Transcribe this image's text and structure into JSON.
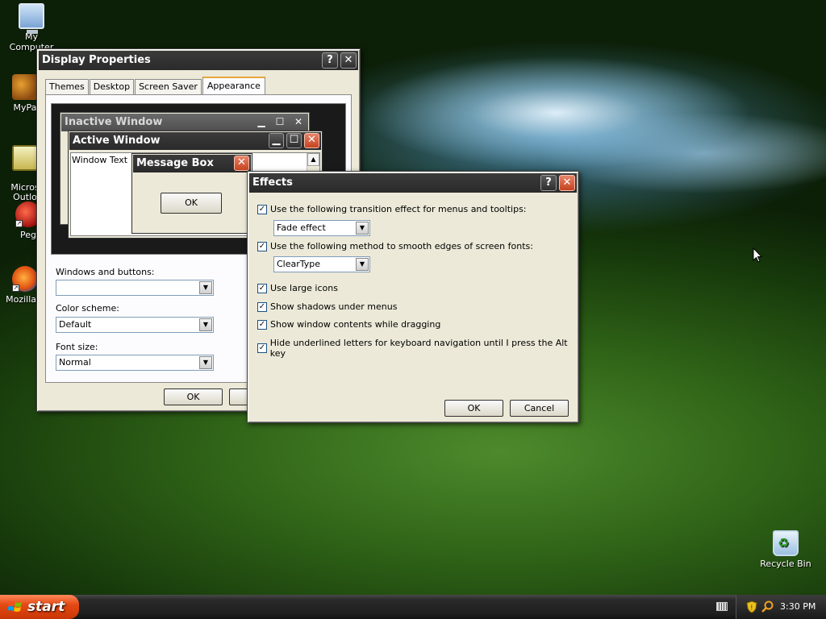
{
  "desktop": {
    "icons": [
      {
        "label": "My Computer"
      },
      {
        "label": "MyPa"
      },
      {
        "label": "Micros\nOutlo"
      },
      {
        "label": "Peg"
      },
      {
        "label": "Mozilla F"
      },
      {
        "label": "Recycle Bin"
      }
    ]
  },
  "display_properties": {
    "title": "Display Properties",
    "help": "?",
    "close": "✕",
    "tabs": [
      "Themes",
      "Desktop",
      "Screen Saver",
      "Appearance"
    ],
    "active_tab": "Appearance",
    "preview": {
      "inactive_title": "Inactive Window",
      "active_title": "Active Window",
      "window_text": "Window Text",
      "message_box_title": "Message Box",
      "message_box_ok": "OK"
    },
    "windows_buttons_label": "Windows and buttons:",
    "windows_buttons_value": "",
    "color_scheme_label": "Color scheme:",
    "color_scheme_value": "Default",
    "font_size_label": "Font size:",
    "font_size_value": "Normal",
    "ok": "OK"
  },
  "effects": {
    "title": "Effects",
    "help": "?",
    "close": "✕",
    "options": [
      {
        "label": "Use the following transition effect for menus and tooltips:",
        "checked": true
      },
      {
        "label": "Use the following method to smooth edges of screen fonts:",
        "checked": true
      },
      {
        "label": "Use large icons",
        "checked": true
      },
      {
        "label": "Show shadows under menus",
        "checked": true
      },
      {
        "label": "Show window contents while dragging",
        "checked": true
      },
      {
        "label": "Hide underlined letters for keyboard navigation until I press the Alt key",
        "checked": true
      }
    ],
    "transition_value": "Fade effect",
    "smoothing_value": "ClearType",
    "ok": "OK",
    "cancel": "Cancel"
  },
  "taskbar": {
    "start": "start",
    "clock": "3:30 PM"
  },
  "colors": {
    "titlebar": "#2a2a2a",
    "close_button": "#c4421e",
    "start_button": "#e44a14"
  }
}
